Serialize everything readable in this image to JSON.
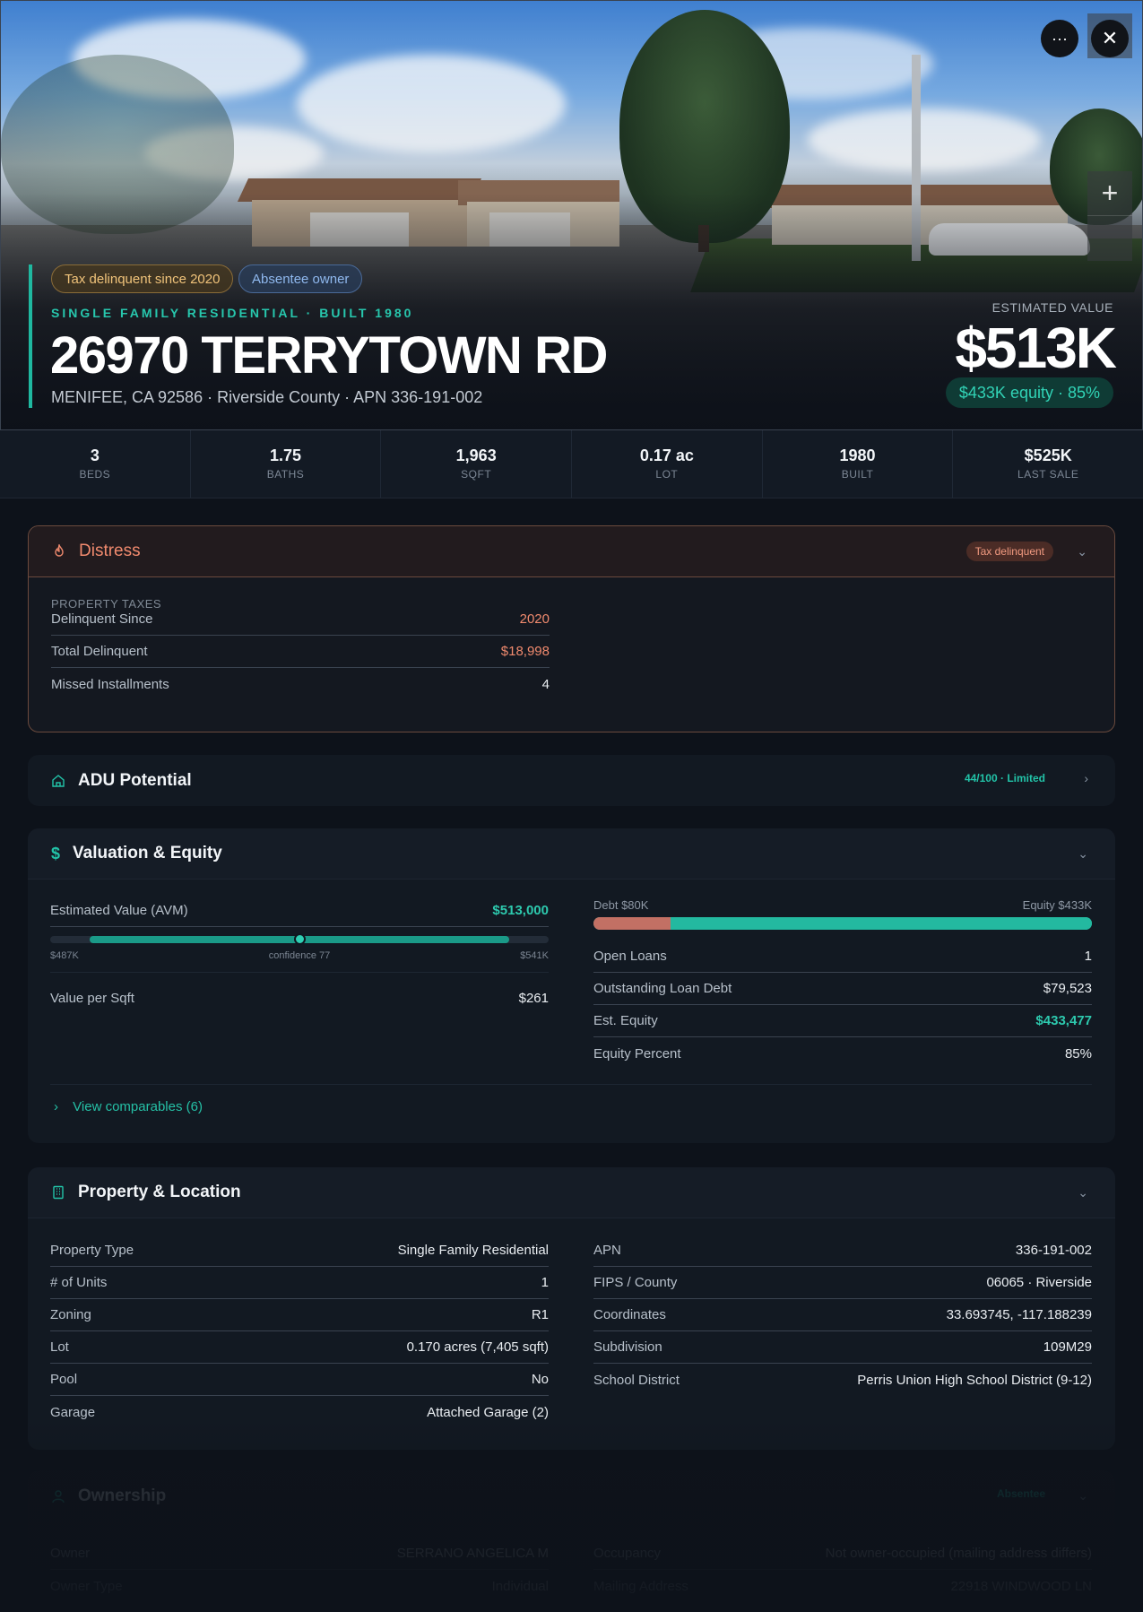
{
  "hero": {
    "chips": {
      "tax": "Tax delinquent since 2020",
      "absentee": "Absentee owner"
    },
    "eyebrow": "SINGLE FAMILY RESIDENTIAL · BUILT 1980",
    "title": "26970 TERRYTOWN RD",
    "subline": "MENIFEE, CA 92586 · Riverside County · APN 336-191-002",
    "estimated_label": "ESTIMATED VALUE",
    "estimated_value": "$513K",
    "equity_pill": "$433K equity · 85%",
    "more_label": "···",
    "close_label": "✕",
    "zoom_in_label": "+"
  },
  "stats": [
    {
      "value": "3",
      "label": "BEDS"
    },
    {
      "value": "1.75",
      "label": "BATHS"
    },
    {
      "value": "1,963",
      "label": "SQFT"
    },
    {
      "value": "0.17 ac",
      "label": "LOT"
    },
    {
      "value": "1980",
      "label": "BUILT"
    },
    {
      "value": "$525K",
      "label": "LAST SALE"
    }
  ],
  "distress": {
    "title": "Distress",
    "badge": "Tax delinquent",
    "section": "PROPERTY TAXES",
    "rows": [
      {
        "label": "Delinquent Since",
        "value": "2020"
      },
      {
        "label": "Total Delinquent",
        "value": "$18,998"
      },
      {
        "label": "Missed Installments",
        "value": "4"
      }
    ]
  },
  "adu": {
    "title": "ADU Potential",
    "badge": "44/100 · Limited"
  },
  "valuation": {
    "title": "Valuation & Equity",
    "avm_label": "Estimated Value (AVM)",
    "avm_value": "$513,000",
    "range_low": "$487K",
    "range_mid": "confidence 77",
    "range_high": "$541K",
    "range_fill": {
      "start": 0.08,
      "end": 0.92
    },
    "range_marker": 0.5,
    "sqft_label": "Value per Sqft",
    "sqft_value": "$261",
    "debt_label": "Debt $80K",
    "equity_label": "Equity $433K",
    "debt_fraction": 0.155,
    "rows": [
      {
        "label": "Open Loans",
        "value": "1"
      },
      {
        "label": "Outstanding Loan Debt",
        "value": "$79,523"
      },
      {
        "label": "Est. Equity",
        "value": "$433,477"
      },
      {
        "label": "Equity Percent",
        "value": "85%"
      }
    ],
    "comparables": "View comparables (6)"
  },
  "property": {
    "title": "Property & Location",
    "left": [
      {
        "label": "Property Type",
        "value": "Single Family Residential"
      },
      {
        "label": "# of Units",
        "value": "1"
      },
      {
        "label": "Zoning",
        "value": "R1"
      },
      {
        "label": "Lot",
        "value": "0.170 acres (7,405 sqft)"
      },
      {
        "label": "Pool",
        "value": "No"
      },
      {
        "label": "Garage",
        "value": "Attached Garage (2)"
      }
    ],
    "right": [
      {
        "label": "APN",
        "value": "336-191-002"
      },
      {
        "label": "FIPS / County",
        "value": "06065 · Riverside"
      },
      {
        "label": "Coordinates",
        "value": "33.693745, -117.188239"
      },
      {
        "label": "Subdivision",
        "value": "109M29"
      },
      {
        "label": "School District",
        "value": "Perris Union High School District (9-12)"
      }
    ]
  },
  "ownership": {
    "title": "Ownership",
    "badge": "Absentee",
    "left": [
      {
        "label": "Owner",
        "value": "SERRANO ANGELICA M"
      },
      {
        "label": "Owner Type",
        "value": "Individual"
      }
    ],
    "right": [
      {
        "label": "Occupancy",
        "value": "Not owner-occupied (mailing address differs)"
      },
      {
        "label": "Mailing Address",
        "value": "22918 WINDWOOD LN"
      }
    ]
  },
  "colors": {
    "accent": "#1fb8a0",
    "distress": "#f08a6e",
    "debt": "#c27064",
    "equity": "#23b9a0"
  }
}
